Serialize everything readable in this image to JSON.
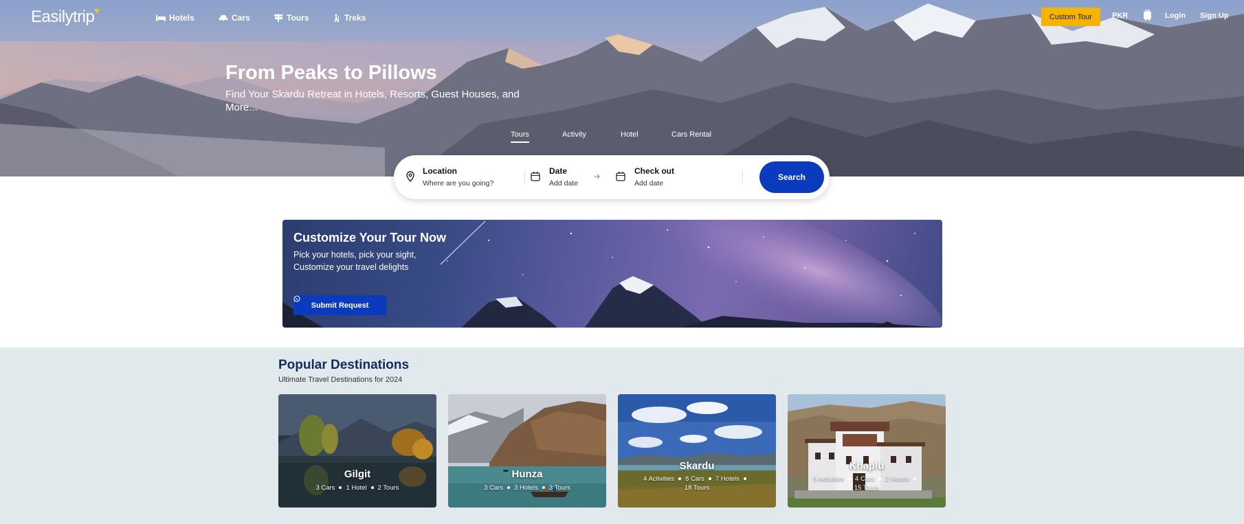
{
  "brand": {
    "name": "Easilytrip",
    "accent": "#f7c21c"
  },
  "nav": {
    "links": [
      {
        "label": "Hotels",
        "icon": "bed-icon"
      },
      {
        "label": "Cars",
        "icon": "car-icon"
      },
      {
        "label": "Tours",
        "icon": "signpost-icon"
      },
      {
        "label": "Treks",
        "icon": "hiker-icon"
      }
    ],
    "custom_tour": "Custom Tour",
    "currency": "PKR",
    "login": "Login",
    "signup": "Sign Up"
  },
  "hero": {
    "title": "From Peaks to Pillows",
    "subtitle": "Find Your Skardu Retreat in Hotels, Resorts, Guest Houses, and More..."
  },
  "tabs": [
    {
      "label": "Tours",
      "active": true
    },
    {
      "label": "Activity",
      "active": false
    },
    {
      "label": "Hotel",
      "active": false
    },
    {
      "label": "Cars Rental",
      "active": false
    }
  ],
  "search": {
    "location_label": "Location",
    "location_placeholder": "Where are you going?",
    "date_label": "Date",
    "date_value": "Add date",
    "checkout_label": "Check out",
    "checkout_value": "Add date",
    "button": "Search",
    "button_color": "#0a3bbd"
  },
  "banner": {
    "title": "Customize Your Tour Now",
    "text": "Pick your hotels, pick your sight, Customize your travel delights",
    "button": "Submit Request"
  },
  "popular": {
    "title": "Popular Destinations",
    "subtitle": "Ultimate Travel Destinations for 2024",
    "cards": [
      {
        "name": "Gilgit",
        "meta": [
          "3 Cars",
          "1 Hotel",
          "2 Tours"
        ]
      },
      {
        "name": "Hunza",
        "meta": [
          "3 Cars",
          "3 Hotels",
          "3 Tours"
        ]
      },
      {
        "name": "Skardu",
        "meta": [
          "4 Activities",
          "8 Cars",
          "7 Hotels",
          "18 Tours"
        ]
      },
      {
        "name": "Khaplu",
        "meta": [
          "5 Activities",
          "4 Cars",
          "2 Hotels",
          "15 Tours"
        ]
      }
    ]
  }
}
